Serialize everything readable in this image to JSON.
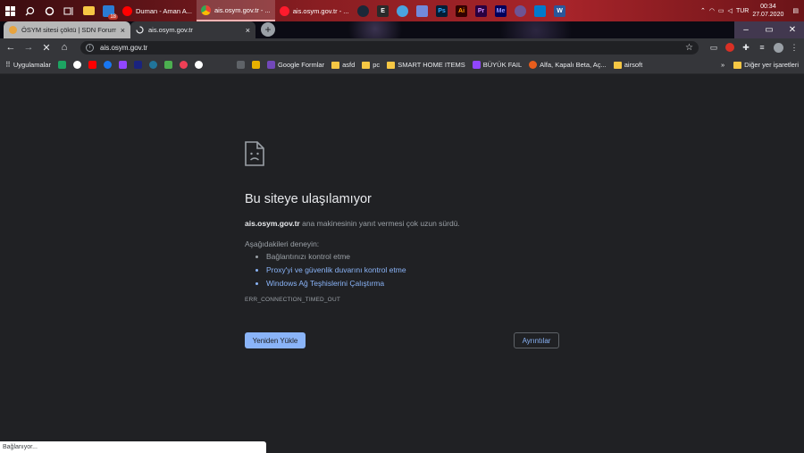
{
  "taskbar": {
    "apps": [
      {
        "label": "Duman - Aman A...",
        "color": "#ff0000",
        "active": false
      },
      {
        "label": "ais.osym.gov.tr - ...",
        "color": "#4285f4",
        "active": true
      },
      {
        "label": "ais.osym.gov.tr - ...",
        "color": "#e4262b",
        "active": false
      }
    ],
    "mail_badge": "18",
    "tray_lang": "TUR",
    "time": "00:34",
    "date": "27.07.2020"
  },
  "tabs": [
    {
      "title": "ÖSYM sitesi çöktü | SDN Forum",
      "state": "inactive"
    },
    {
      "title": "ais.osym.gov.tr",
      "state": "active"
    }
  ],
  "omnibox": {
    "url": "ais.osym.gov.tr"
  },
  "bookmarks": {
    "apps_label": "Uygulamalar",
    "items": [
      {
        "label": "Google Formlar",
        "type": "site",
        "color": "#7248b9"
      },
      {
        "label": "asfd",
        "type": "folder"
      },
      {
        "label": "pc",
        "type": "folder"
      },
      {
        "label": "SMART HOME ITEMS",
        "type": "folder"
      },
      {
        "label": "BÜYÜK FAIL",
        "type": "site",
        "color": "#9146ff"
      },
      {
        "label": "Alfa, Kapalı Beta, Aç...",
        "type": "site",
        "color": "#e85d1c"
      },
      {
        "label": "airsoft",
        "type": "folder"
      }
    ],
    "overflow": "»",
    "other_label": "Diğer yer işaretleri"
  },
  "error": {
    "title": "Bu siteye ulaşılamıyor",
    "host": "ais.osym.gov.tr",
    "desc_rest": " ana makinesinin yanıt vermesi çok uzun sürdü.",
    "try_label": "Aşağıdakileri deneyin:",
    "suggestions": [
      {
        "text": "Bağlantınızı kontrol etme",
        "link": false
      },
      {
        "text": "Proxy'yi ve güvenlik duvarını kontrol etme",
        "link": true
      },
      {
        "text": "Windows Ağ Teşhislerini Çalıştırma",
        "link": true
      }
    ],
    "code": "ERR_CONNECTION_TIMED_OUT",
    "reload_label": "Yeniden Yükle",
    "details_label": "Ayrıntılar"
  },
  "status": {
    "text": "Bağlanıyor..."
  }
}
